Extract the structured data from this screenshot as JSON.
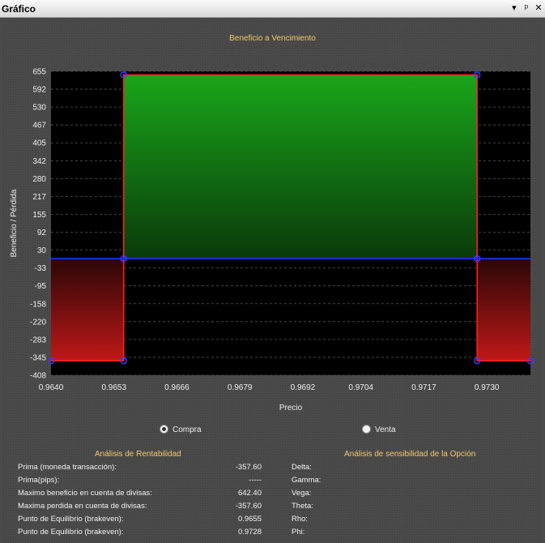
{
  "window": {
    "title": "Gráfico",
    "pin_glyph": "▾",
    "dock_glyph": "ᵖ",
    "close_glyph": "✕"
  },
  "chart_data": {
    "type": "area",
    "title": "Beneficio a Vencimiento",
    "xlabel": "Precio",
    "ylabel": "Beneficio / Pérdida",
    "xlim": [
      0.964,
      0.9739
    ],
    "ylim": [
      -408,
      655
    ],
    "x_ticks": [
      "0.9640",
      "0.9653",
      "0.9666",
      "0.9679",
      "0.9692",
      "0.9704",
      "0.9717",
      "0.9730"
    ],
    "y_ticks": [
      "655",
      "592",
      "530",
      "467",
      "405",
      "342",
      "280",
      "217",
      "155",
      "92",
      "30",
      "-33",
      "-95",
      "-158",
      "-220",
      "-283",
      "-345",
      "-408"
    ],
    "zero_line": 0,
    "points": [
      {
        "x": 0.964,
        "y": -357.6
      },
      {
        "x": 0.9655,
        "y": -357.6
      },
      {
        "x": 0.9655,
        "y": 0
      },
      {
        "x": 0.9655,
        "y": 642.4
      },
      {
        "x": 0.9728,
        "y": 642.4
      },
      {
        "x": 0.9728,
        "y": 0
      },
      {
        "x": 0.9728,
        "y": -357.6
      },
      {
        "x": 0.9739,
        "y": -357.6
      }
    ],
    "grid": true,
    "colors": {
      "profit": "#1aa61a",
      "loss": "#c01818",
      "outline": "#ff2020",
      "zero": "#1a2fd6",
      "marker": "#3b3bff",
      "plot_bg": "#000000"
    }
  },
  "options": {
    "compra": "Compra",
    "venta": "Venta",
    "selected": "compra"
  },
  "rentabilidad": {
    "title": "Análisis de Rentabilidad",
    "rows": [
      {
        "label": "Prima (moneda transacción):",
        "value": "-357.60"
      },
      {
        "label": "Prima(pips):",
        "value": "-----"
      },
      {
        "label": "Maximo beneficio en cuenta de divisas:",
        "value": "642.40"
      },
      {
        "label": "Maxima perdida en cuenta de divisas:",
        "value": "-357.60"
      },
      {
        "label": "Punto de Equilibrio (brakeven):",
        "value": "0.9655"
      },
      {
        "label": "Punto de Equilibrio (brakeven):",
        "value": "0.9728"
      }
    ]
  },
  "sensibilidad": {
    "title": "Análisis de sensibilidad de la Opción",
    "rows": [
      "Delta:",
      "Gamma:",
      "Vega:",
      "Theta:",
      "Rho:",
      "Phi:"
    ]
  }
}
